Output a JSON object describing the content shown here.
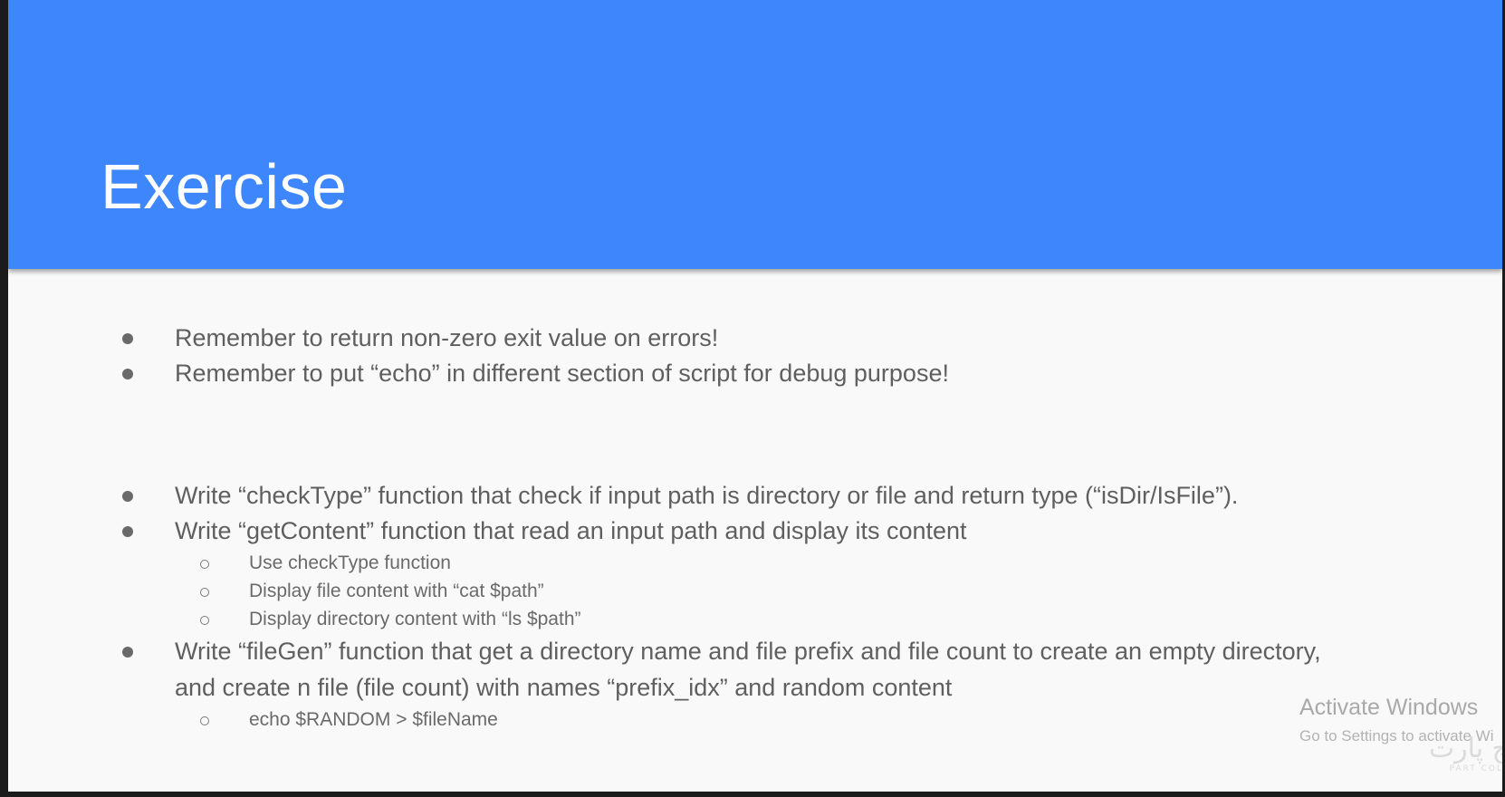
{
  "slide": {
    "title": "Exercise",
    "tips": [
      "Remember to return non-zero exit value on errors!",
      "Remember to put “echo” in different section of script for debug purpose!"
    ],
    "tasks": [
      {
        "text": "Write “checkType” function that check if input path is directory or file and return type (“isDir/IsFile”)."
      },
      {
        "text": "Write “getContent” function that read an input path and display its content",
        "subitems": [
          "Use checkType function",
          "Display file content with “cat $path”",
          "Display directory content with “ls $path”"
        ]
      },
      {
        "text_line1": "Write “fileGen” function that get a directory name and file prefix and file count to create an empty directory,",
        "text_line2": "and create n file (file count) with names “prefix_idx” and random content",
        "subitems": [
          "echo $RANDOM > $fileName"
        ]
      }
    ]
  },
  "watermark": {
    "title": "Activate Windows",
    "subtitle": "Go to Settings to activate Wi",
    "logo_text": "چ پارت",
    "logo_caption": "PART COLL"
  },
  "colors": {
    "header": "#3d86fb",
    "background": "#f9f9f9",
    "text": "#5f5f5f"
  }
}
